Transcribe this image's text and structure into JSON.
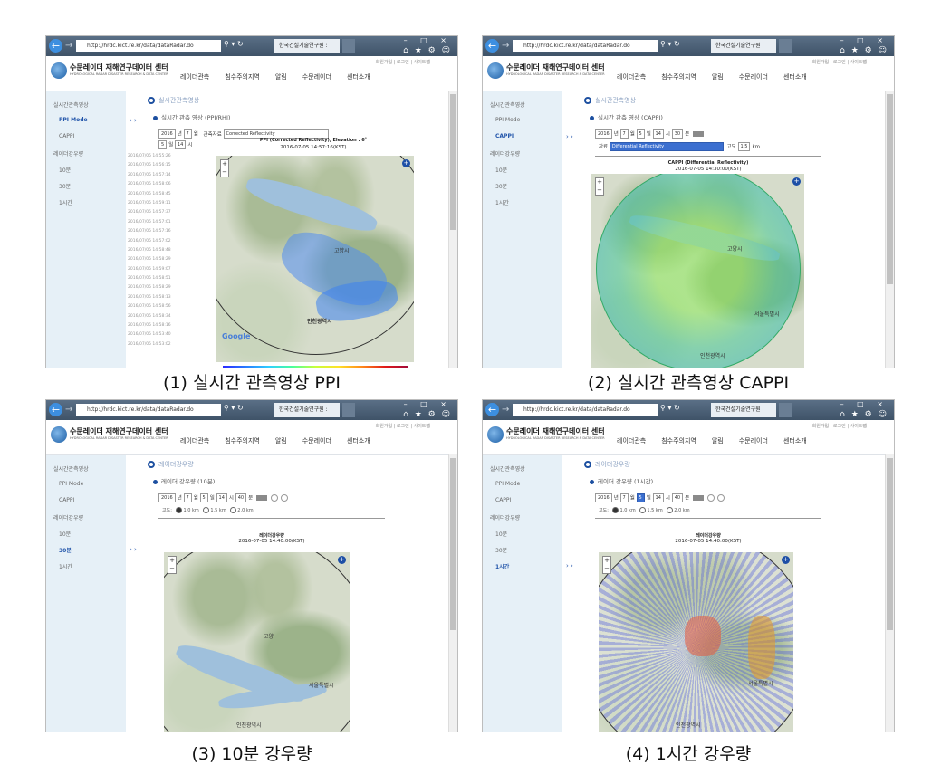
{
  "browser": {
    "address": "http://hrdc.kict.re.kr/data/dataRadar.do",
    "tab_title": "한국건설기술연구원 :",
    "window_controls": "– □ ×",
    "toolbar_icons": "⌂ ★ ⚙ ☺"
  },
  "site": {
    "title": "수문레이더 재해연구데이터 센터",
    "subtitle": "HYDROLOGICAL RADAR DISASTER RESEARCH & DATA CENTER",
    "utility": "회원가입 | 로그인 | 사이트맵",
    "nav": [
      "레이더관측",
      "침수주의지역",
      "알림",
      "수문레이더",
      "센터소개"
    ]
  },
  "sidebar": {
    "items": [
      "실시간관측영상",
      "PPI Mode",
      "CAPPI",
      "레이더강우량",
      "10분",
      "30분",
      "1시간"
    ]
  },
  "panels": [
    {
      "caption": "(1) 실시간 관측영상 PPI",
      "breadcrumb": "실시간관측영상",
      "section_title": "실시간 관측 영상 (PPI/RHI)",
      "controls": {
        "year": "2016",
        "month": "7",
        "day": "5",
        "hour": "14",
        "product_label": "관측자료",
        "product": "Corrected Reflectivity"
      },
      "map_title": "PPI (Corrected Reflectivity), Elevation : 6˚",
      "map_time": "2016-07-05 14:57:16(KST)",
      "time_list": [
        "2016/07/05 14:55:26",
        "2016/07/05 14:56:15",
        "2016/07/05 14:57:14",
        "2016/07/05 14:58:06",
        "2016/07/05 14:58:45",
        "2016/07/05 14:59:11",
        "2016/07/05 14:57:37",
        "2016/07/05 14:57:01",
        "2016/07/05 14:57:16",
        "2016/07/05 14:57:02",
        "2016/07/05 14:58:48",
        "2016/07/05 14:58:29",
        "2016/07/05 14:59:07",
        "2016/07/05 14:58:51",
        "2016/07/05 14:58:29",
        "2016/07/05 14:58:13",
        "2016/07/05 14:58:56",
        "2016/07/05 14:58:34",
        "2016/07/05 14:58:16",
        "2016/07/05 14:53:40",
        "2016/07/05 14:53:02"
      ],
      "labels": {
        "city1": "고양시",
        "city2": "인천광역시",
        "google": "Google"
      }
    },
    {
      "caption": "(2) 실시간 관측영상 CAPPI",
      "breadcrumb": "실시간관측영상",
      "section_title": "실시간 관측 영상 (CAPPI)",
      "controls": {
        "year": "2016",
        "month": "7",
        "day": "5",
        "hour": "14",
        "minute": "30",
        "product_label": "자료",
        "product": "Differential Reflectivity",
        "height_label": "고도",
        "height": "1.5",
        "height_unit": "km"
      },
      "map_title": "CAPPI (Differential Reflectivity)",
      "map_time": "2016-07-05 14:30:00(KST)",
      "labels": {
        "city1": "고양시",
        "city2": "서울특별시",
        "city3": "인천광역시"
      }
    },
    {
      "caption": "(3) 10분 강우량",
      "breadcrumb": "레이더강우량",
      "section_title": "레이더 강우량 (10분)",
      "controls": {
        "year": "2016",
        "month": "7",
        "day": "5",
        "hour": "14",
        "minute": "40",
        "height_label": "고도",
        "heights": [
          "1.0 km",
          "1.5 km",
          "2.0 km"
        ]
      },
      "map_title": "레이더강우량",
      "map_time": "2016-07-05 14:40:00(KST)",
      "labels": {
        "city1": "고양",
        "city2": "서울특별시",
        "city3": "인천광역시"
      }
    },
    {
      "caption": "(4) 1시간 강우량",
      "breadcrumb": "레이더강우량",
      "section_title": "레이더 강우량 (1시간)",
      "controls": {
        "year": "2016",
        "month": "7",
        "day": "5",
        "hour": "14",
        "minute": "40",
        "height_label": "고도",
        "heights": [
          "1.0 km",
          "1.5 km",
          "2.0 km"
        ]
      },
      "map_title": "레이더강우량",
      "map_time": "2016-07-05 14:40:00(KST)",
      "labels": {
        "city1": "서울특별시",
        "city2": "인천광역시"
      }
    }
  ],
  "icons": {
    "back": "back-arrow-icon",
    "zoom": "zoom-control-icon",
    "fullscreen": "fullscreen-icon"
  }
}
